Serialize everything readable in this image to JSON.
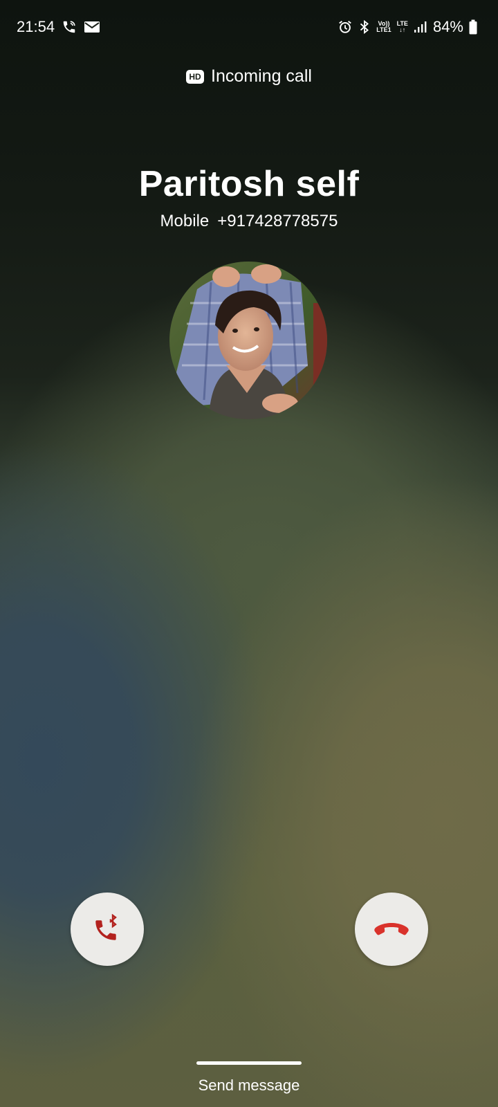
{
  "status_bar": {
    "time": "21:54",
    "volte_top": "Vo))",
    "volte_bottom": "LTE1",
    "lte_top": "LTE",
    "lte_bottom": "↓↑",
    "battery": "84%",
    "left_icons": [
      "wifi-call-icon",
      "mail-icon"
    ],
    "right_icons": [
      "alarm-icon",
      "bluetooth-icon",
      "signal-icon",
      "battery-icon"
    ]
  },
  "call": {
    "hd_label": "HD",
    "status": "Incoming call",
    "caller_name": "Paritosh self",
    "number_type": "Mobile",
    "number": "+917428778575"
  },
  "actions": {
    "accept_icon": "bluetooth-phone-icon",
    "decline_icon": "hang-up-icon",
    "send_message": "Send message"
  },
  "colors": {
    "button_bg": "#ecebe8",
    "accept_icon": "#b3221e",
    "decline_icon": "#d9322b"
  }
}
